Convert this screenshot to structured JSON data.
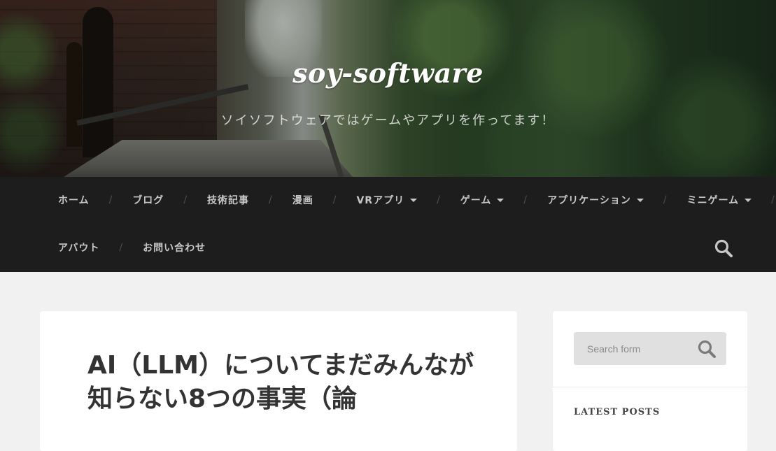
{
  "site": {
    "title": "soy-software",
    "tagline": "ソイソフトウェアではゲームやアプリを作ってます！"
  },
  "nav": {
    "row1": [
      {
        "label": "ホーム",
        "has_dropdown": false
      },
      {
        "label": "ブログ",
        "has_dropdown": false
      },
      {
        "label": "技術記事",
        "has_dropdown": false
      },
      {
        "label": "漫画",
        "has_dropdown": false
      },
      {
        "label": "VRアプリ",
        "has_dropdown": true
      },
      {
        "label": "ゲーム",
        "has_dropdown": true
      },
      {
        "label": "アプリケーション",
        "has_dropdown": true
      },
      {
        "label": "ミニゲーム",
        "has_dropdown": true
      }
    ],
    "row2": [
      {
        "label": "アバウト",
        "has_dropdown": false
      },
      {
        "label": "お問い合わせ",
        "has_dropdown": false
      }
    ],
    "separator": "/",
    "search_icon": "search-icon"
  },
  "post": {
    "title": "AI（LLM）についてまだみんなが知らない8つの事実（論"
  },
  "sidebar": {
    "search_placeholder": "Search form",
    "latest_posts_title": "LATEST POSTS"
  },
  "colors": {
    "nav_bg": "#1d1d1d",
    "nav_text": "#c7c7c7",
    "page_bg": "#f1f1f1",
    "card_bg": "#ffffff",
    "search_bg": "#e0e0e0"
  }
}
